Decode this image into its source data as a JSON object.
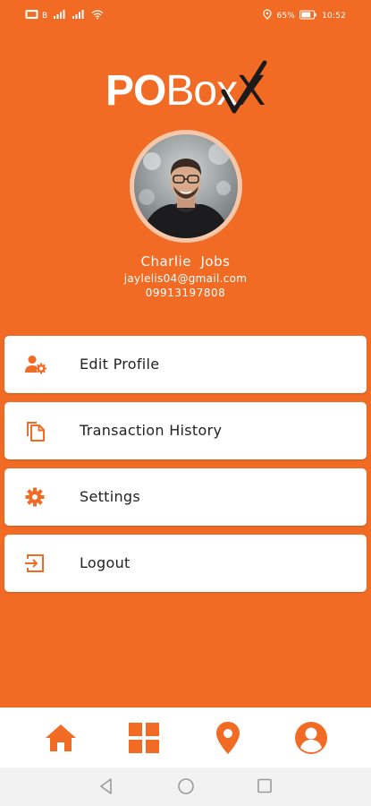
{
  "status_bar": {
    "carrier_badge": "VoLTE",
    "sim_1": "B",
    "battery_percent": "65%",
    "time": "10:52",
    "icons": [
      "volte-icon",
      "signal-icon",
      "signal-icon",
      "wifi-icon",
      "location-icon",
      "battery-icon"
    ]
  },
  "logo": {
    "text_bold": "PO",
    "text_light": "Box",
    "text_accent": "X"
  },
  "profile": {
    "name": "Charlie  Jobs",
    "email": "jaylelis04@gmail.com",
    "phone": "09913197808"
  },
  "menu": [
    {
      "label": "Edit Profile",
      "icon": "edit-profile-icon"
    },
    {
      "label": "Transaction History",
      "icon": "copy-documents-icon"
    },
    {
      "label": "Settings",
      "icon": "gear-icon"
    },
    {
      "label": "Logout",
      "icon": "logout-icon"
    }
  ],
  "bottom_nav": [
    {
      "icon": "home-icon",
      "active": false
    },
    {
      "icon": "grid-icon",
      "active": false
    },
    {
      "icon": "location-pin-icon",
      "active": false
    },
    {
      "icon": "profile-icon",
      "active": true
    }
  ],
  "system_nav": [
    "back-icon",
    "home-circle-icon",
    "recents-icon"
  ],
  "colors": {
    "brand_orange": "#f26b24",
    "card_bg": "#ffffff",
    "avatar_ring": "#f7c7a9",
    "nav_bg": "#ffffff",
    "system_nav_bg": "#f2f2f2"
  }
}
